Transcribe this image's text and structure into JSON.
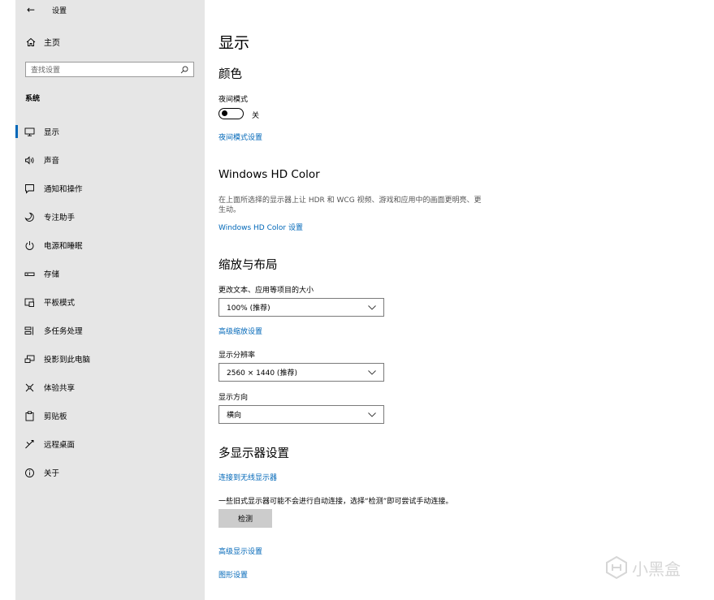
{
  "window": {
    "title": "设置"
  },
  "sidebar": {
    "home_label": "主页",
    "search_placeholder": "查找设置",
    "section": "系统",
    "items": [
      {
        "label": "显示",
        "icon": "monitor-icon",
        "selected": true
      },
      {
        "label": "声音",
        "icon": "speaker-icon"
      },
      {
        "label": "通知和操作",
        "icon": "notification-icon"
      },
      {
        "label": "专注助手",
        "icon": "moon-icon"
      },
      {
        "label": "电源和睡眠",
        "icon": "power-icon"
      },
      {
        "label": "存储",
        "icon": "storage-icon"
      },
      {
        "label": "平板模式",
        "icon": "tablet-icon"
      },
      {
        "label": "多任务处理",
        "icon": "multitask-icon"
      },
      {
        "label": "投影到此电脑",
        "icon": "projector-icon"
      },
      {
        "label": "体验共享",
        "icon": "share-icon"
      },
      {
        "label": "剪贴板",
        "icon": "clipboard-icon"
      },
      {
        "label": "远程桌面",
        "icon": "remote-desktop-icon"
      },
      {
        "label": "关于",
        "icon": "info-icon"
      }
    ]
  },
  "main": {
    "title": "显示",
    "color": {
      "heading": "颜色",
      "night_light_label": "夜间模式",
      "night_light_state": "关",
      "night_light_on": false,
      "night_light_settings_link": "夜间模式设置"
    },
    "hdr": {
      "heading": "Windows HD Color",
      "description": "在上面所选择的显示器上让 HDR 和 WCG 视频、游戏和应用中的画面更明亮、更生动。",
      "settings_link": "Windows HD Color 设置"
    },
    "scale": {
      "heading": "缩放与布局",
      "text_size_label": "更改文本、应用等项目的大小",
      "text_size_value": "100% (推荐)",
      "advanced_scaling_link": "高级缩放设置",
      "resolution_label": "显示分辨率",
      "resolution_value": "2560 × 1440 (推荐)",
      "orientation_label": "显示方向",
      "orientation_value": "横向"
    },
    "multi": {
      "heading": "多显示器设置",
      "wireless_link": "连接到无线显示器",
      "detect_note": "一些旧式显示器可能不会进行自动连接，选择“检测”即可尝试手动连接。",
      "detect_button": "检测",
      "advanced_display_link": "高级显示设置",
      "graphics_link": "图形设置"
    }
  },
  "watermark": {
    "text": "小黑盒"
  },
  "colors": {
    "accent": "#0067b8",
    "sidebar_bg": "#e6e6e6",
    "button_bg": "#cccccc"
  }
}
